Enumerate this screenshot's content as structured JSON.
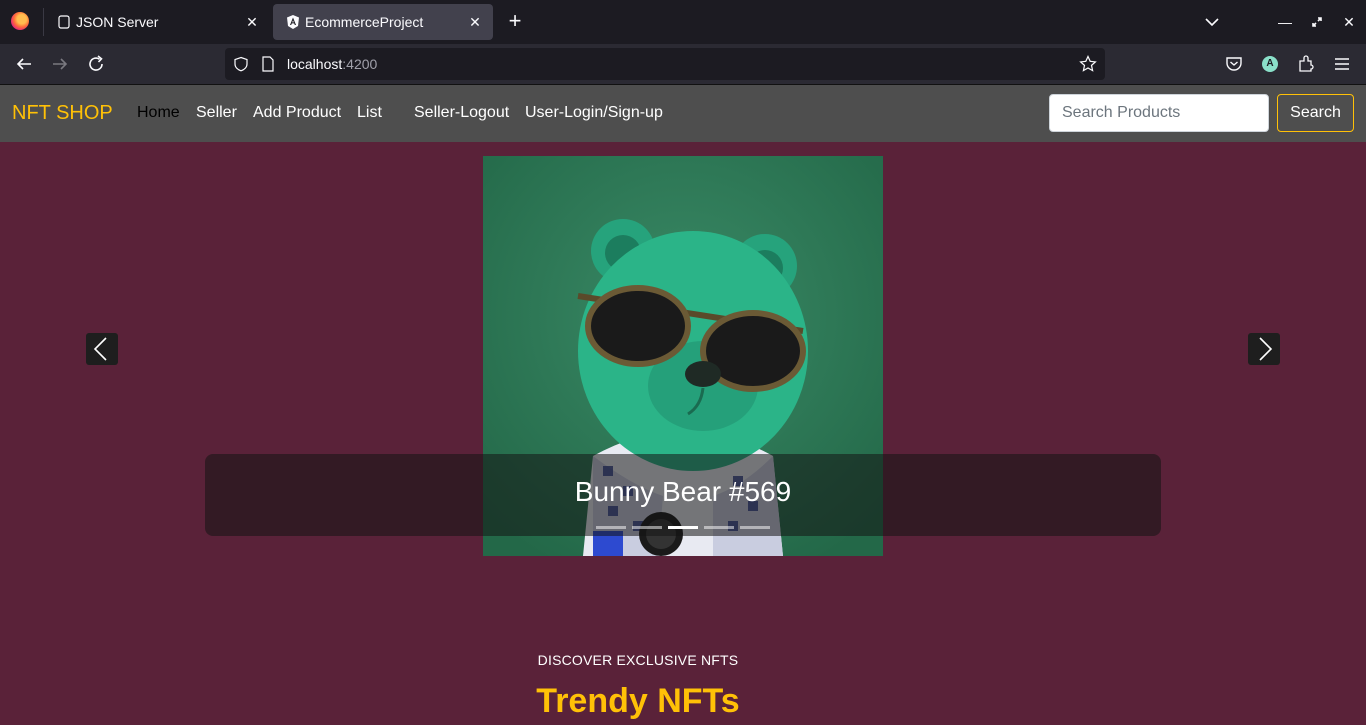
{
  "browser": {
    "tabs": [
      {
        "title": "JSON Server"
      },
      {
        "title": "EcommerceProject"
      }
    ],
    "url": {
      "host": "localhost",
      "port": ":4200"
    }
  },
  "app": {
    "brand": "NFT SHOP",
    "nav": [
      {
        "label": "Home",
        "active": true
      },
      {
        "label": "Seller"
      },
      {
        "label": "Add Product"
      },
      {
        "label": "List"
      },
      {
        "label": "Seller-Logout"
      },
      {
        "label": "User-Login/Sign-up"
      }
    ],
    "search": {
      "placeholder": "Search Products",
      "button": "Search"
    }
  },
  "carousel": {
    "caption": "Bunny Bear #569",
    "indicator_count": 5,
    "active_index": 2
  },
  "section": {
    "kicker": "DISCOVER EXCLUSIVE NFTS",
    "headline": "Trendy NFTs"
  },
  "colors": {
    "page_bg": "#5a2239",
    "accent": "#ffc107",
    "navbar": "#4e4e4e"
  }
}
